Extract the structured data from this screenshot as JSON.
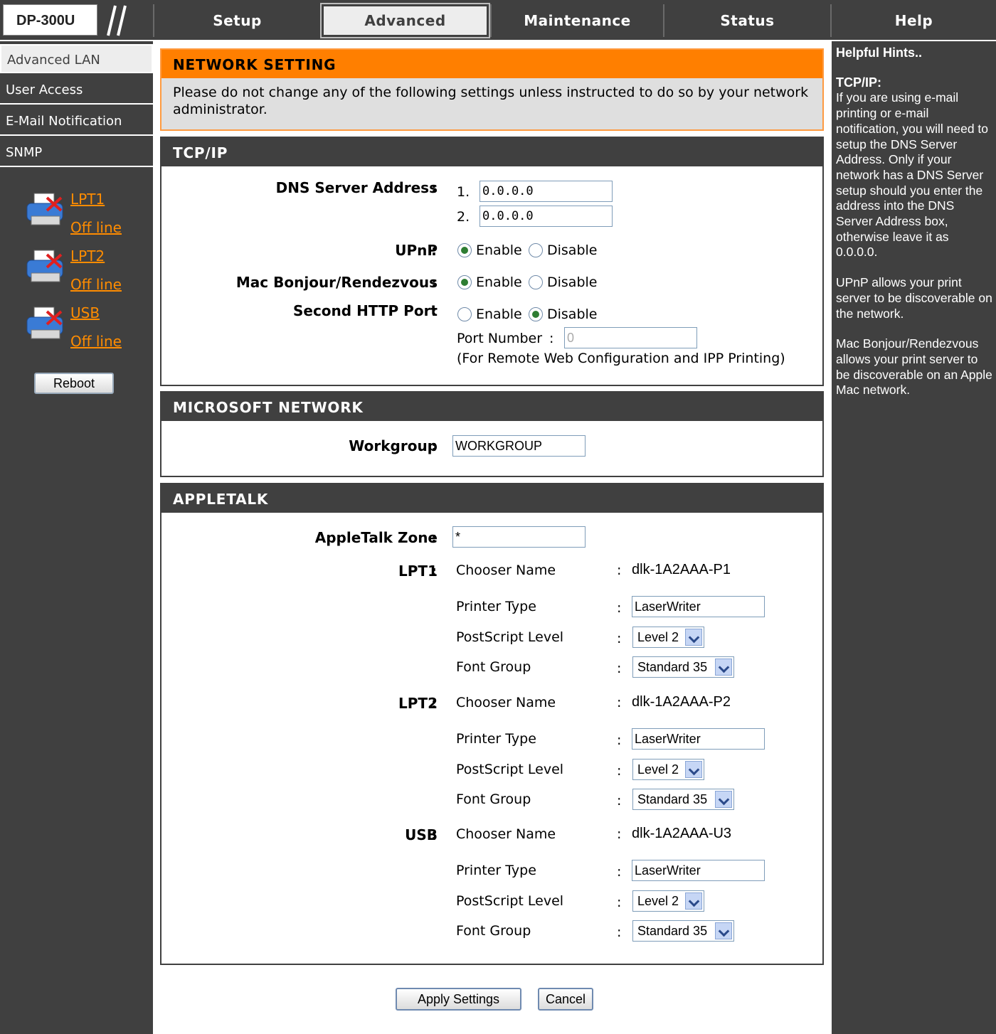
{
  "header": {
    "model": "DP-300U",
    "tabs": [
      "Setup",
      "Advanced",
      "Maintenance",
      "Status",
      "Help"
    ],
    "active_tab": "Advanced"
  },
  "leftnav": {
    "items": [
      "Advanced LAN",
      "User Access",
      "E-Mail Notification",
      "SNMP"
    ],
    "active_item": "Advanced LAN",
    "printers": [
      {
        "name": "LPT1",
        "status": "Off line"
      },
      {
        "name": "LPT2",
        "status": "Off line"
      },
      {
        "name": "USB",
        "status": "Off line"
      }
    ],
    "reboot_label": "Reboot"
  },
  "network_setting": {
    "title": "NETWORK SETTING",
    "notice": "Please do not change any of the following settings unless instructed to do so by your network administrator."
  },
  "tcpip": {
    "title": "TCP/IP",
    "dns_label": "DNS Server Address",
    "dns1_prefix": "1.",
    "dns2_prefix": "2.",
    "dns1": "0.0.0.0",
    "dns2": "0.0.0.0",
    "upnp_label": "UPnP",
    "upnp_value": "Enable",
    "bonjour_label": "Mac Bonjour/Rendezvous",
    "bonjour_value": "Enable",
    "http_label": "Second HTTP Port",
    "http_value": "Disable",
    "enable": "Enable",
    "disable": "Disable",
    "port_label": "Port Number",
    "port_value": "0",
    "port_note": "(For Remote Web Configuration and IPP Printing)",
    "colon": ":"
  },
  "microsoft": {
    "title": "MICROSOFT NETWORK",
    "workgroup_label": "Workgroup",
    "workgroup_value": "WORKGROUP"
  },
  "appletalk": {
    "title": "APPLETALK",
    "zone_label": "AppleTalk Zone",
    "zone_value": "*",
    "field_labels": {
      "chooser": "Chooser Name",
      "printer_type": "Printer Type",
      "ps_level": "PostScript Level",
      "font_group": "Font Group"
    },
    "ports": [
      {
        "name": "LPT1",
        "chooser": "dlk-1A2AAA-P1",
        "printer_type": "LaserWriter",
        "ps_level": "Level 2",
        "font_group": "Standard 35"
      },
      {
        "name": "LPT2",
        "chooser": "dlk-1A2AAA-P2",
        "printer_type": "LaserWriter",
        "ps_level": "Level 2",
        "font_group": "Standard 35"
      },
      {
        "name": "USB",
        "chooser": "dlk-1A2AAA-U3",
        "printer_type": "LaserWriter",
        "ps_level": "Level 2",
        "font_group": "Standard 35"
      }
    ]
  },
  "buttons": {
    "apply": "Apply Settings",
    "cancel": "Cancel"
  },
  "help": {
    "title": "Helpful Hints..",
    "tcpip_heading": "TCP/IP:",
    "tcpip_text": "If you are using e-mail printing or e-mail notification, you will need to setup the DNS Server Address. Only if your network has a DNS Server setup should you enter the address into the DNS Server Address box, otherwise leave it as 0.0.0.0.",
    "upnp_text": "UPnP allows your print server to be discoverable on the network.",
    "bonjour_text": "Mac Bonjour/Rendezvous allows your print server to be discoverable on an Apple Mac network."
  },
  "colors": {
    "dark": "#404040",
    "orange": "#ff7f00",
    "link": "#ff8c00"
  }
}
